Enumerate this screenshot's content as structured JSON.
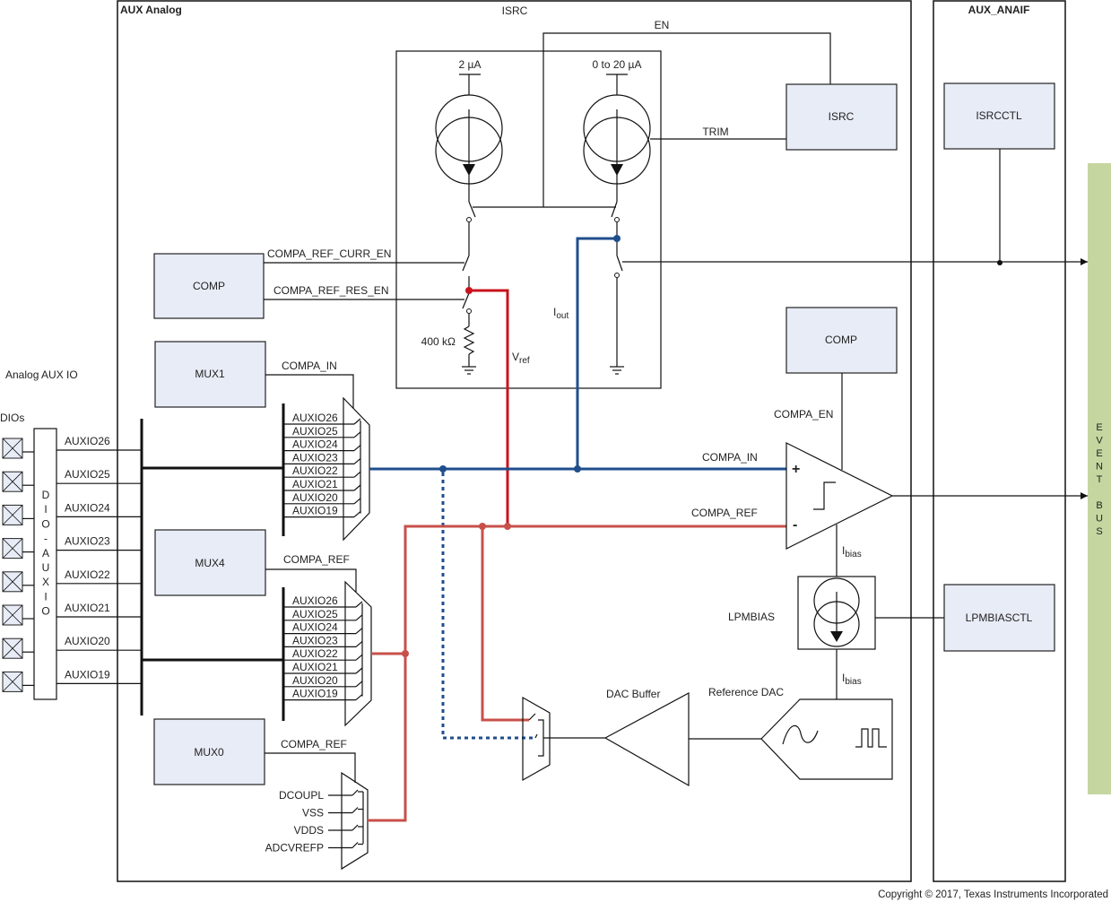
{
  "regions": {
    "aux_analog": "AUX Analog",
    "aux_anaif": "AUX_ANAIF",
    "isrc_title": "ISRC",
    "analog_aux_io": "Analog AUX IO",
    "dios": "DIOs",
    "dio_auxio_letters": [
      "D",
      "I",
      "O",
      "-",
      "A",
      "U",
      "X",
      "I",
      "O"
    ]
  },
  "blocks": {
    "isrc": "ISRC",
    "isrcctl": "ISRCCTL",
    "comp_left": "COMP",
    "comp_right": "COMP",
    "mux1": "MUX1",
    "mux4": "MUX4",
    "mux0": "MUX0",
    "lpmbiasctl": "LPMBIASCTL"
  },
  "signals": {
    "en": "EN",
    "trim": "TRIM",
    "src_2ua": "2 µA",
    "src_0_20ua": "0 to 20 µA",
    "compa_ref_curr_en": "COMPA_REF_CURR_EN",
    "compa_ref_res_en": "COMPA_REF_RES_EN",
    "resistor": "400 kΩ",
    "vref_main": "V",
    "vref_sub": "ref",
    "iout_main": "I",
    "iout_sub": "out",
    "mux1_out": "COMPA_IN",
    "mux4_out": "COMPA_REF",
    "mux0_out": "COMPA_REF",
    "compa_en": "COMPA_EN",
    "compa_in": "COMPA_IN",
    "compa_ref": "COMPA_REF",
    "plus": "+",
    "minus": "-",
    "ibias_main": "I",
    "ibias_sub": "bias",
    "lpmbias": "LPMBIAS",
    "dac_buffer": "DAC Buffer",
    "reference_dac": "Reference DAC",
    "event_bus_letters": [
      "E",
      "V",
      "E",
      "N",
      "T",
      "",
      "B",
      "U",
      "S"
    ]
  },
  "auxio_pins": [
    "AUXIO26",
    "AUXIO25",
    "AUXIO24",
    "AUXIO23",
    "AUXIO22",
    "AUXIO21",
    "AUXIO20",
    "AUXIO19"
  ],
  "mux1_inputs": [
    "AUXIO26",
    "AUXIO25",
    "AUXIO24",
    "AUXIO23",
    "AUXIO22",
    "AUXIO21",
    "AUXIO20",
    "AUXIO19"
  ],
  "mux4_inputs": [
    "AUXIO26",
    "AUXIO25",
    "AUXIO24",
    "AUXIO23",
    "AUXIO22",
    "AUXIO21",
    "AUXIO20",
    "AUXIO19"
  ],
  "mux0_inputs": [
    "DCOUPL",
    "VSS",
    "VDDS",
    "ADCVREFP"
  ],
  "colors": {
    "block_fill": "#e8ecf6",
    "event_bus": "#c5d6a0",
    "compa_in_wire": "#1f4e8c",
    "compa_ref_wire": "#c8504a",
    "vref_wire": "#c8141c"
  },
  "footer": {
    "copyright": "Copyright © 2017, Texas Instruments Incorporated"
  }
}
